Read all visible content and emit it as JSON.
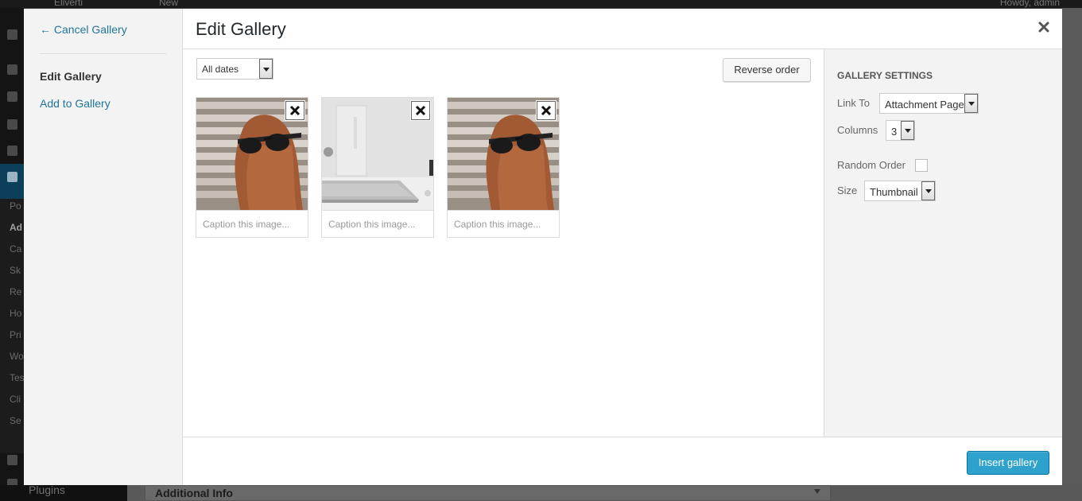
{
  "background": {
    "adminbar": {
      "site": "Eliverti",
      "new_label": "New",
      "howdy": "Howdy, admin"
    },
    "sidebar_items": [
      "Po",
      "Ad",
      "Ca",
      "Sk",
      "Re",
      "Ho",
      "Pri",
      "Wo",
      "Tes",
      "Cli",
      "Se"
    ],
    "plugins_label": "Plugins",
    "additional_info": "Additional Info"
  },
  "menu": {
    "cancel": "← Cancel Gallery",
    "items": [
      {
        "label": "Edit Gallery",
        "active": true
      },
      {
        "label": "Add to Gallery",
        "active": false
      }
    ]
  },
  "title": "Edit Gallery",
  "toolbar": {
    "date_filter": "All dates",
    "reverse_label": "Reverse order"
  },
  "attachments": [
    {
      "caption_placeholder": "Caption this image...",
      "image": "woman-sunglasses-photo"
    },
    {
      "caption_placeholder": "Caption this image...",
      "image": "laptop-desk-photo"
    },
    {
      "caption_placeholder": "Caption this image...",
      "image": "woman-sunglasses-photo"
    }
  ],
  "settings": {
    "heading": "Gallery Settings",
    "link_to_label": "Link To",
    "link_to_value": "Attachment Page",
    "columns_label": "Columns",
    "columns_value": "3",
    "random_label": "Random Order",
    "random_checked": false,
    "size_label": "Size",
    "size_value": "Thumbnail"
  },
  "footer": {
    "insert_label": "Insert gallery"
  },
  "colors": {
    "primary_button": "#2ea2cc",
    "link": "#21759b",
    "overlay": "#3c3c3c"
  }
}
